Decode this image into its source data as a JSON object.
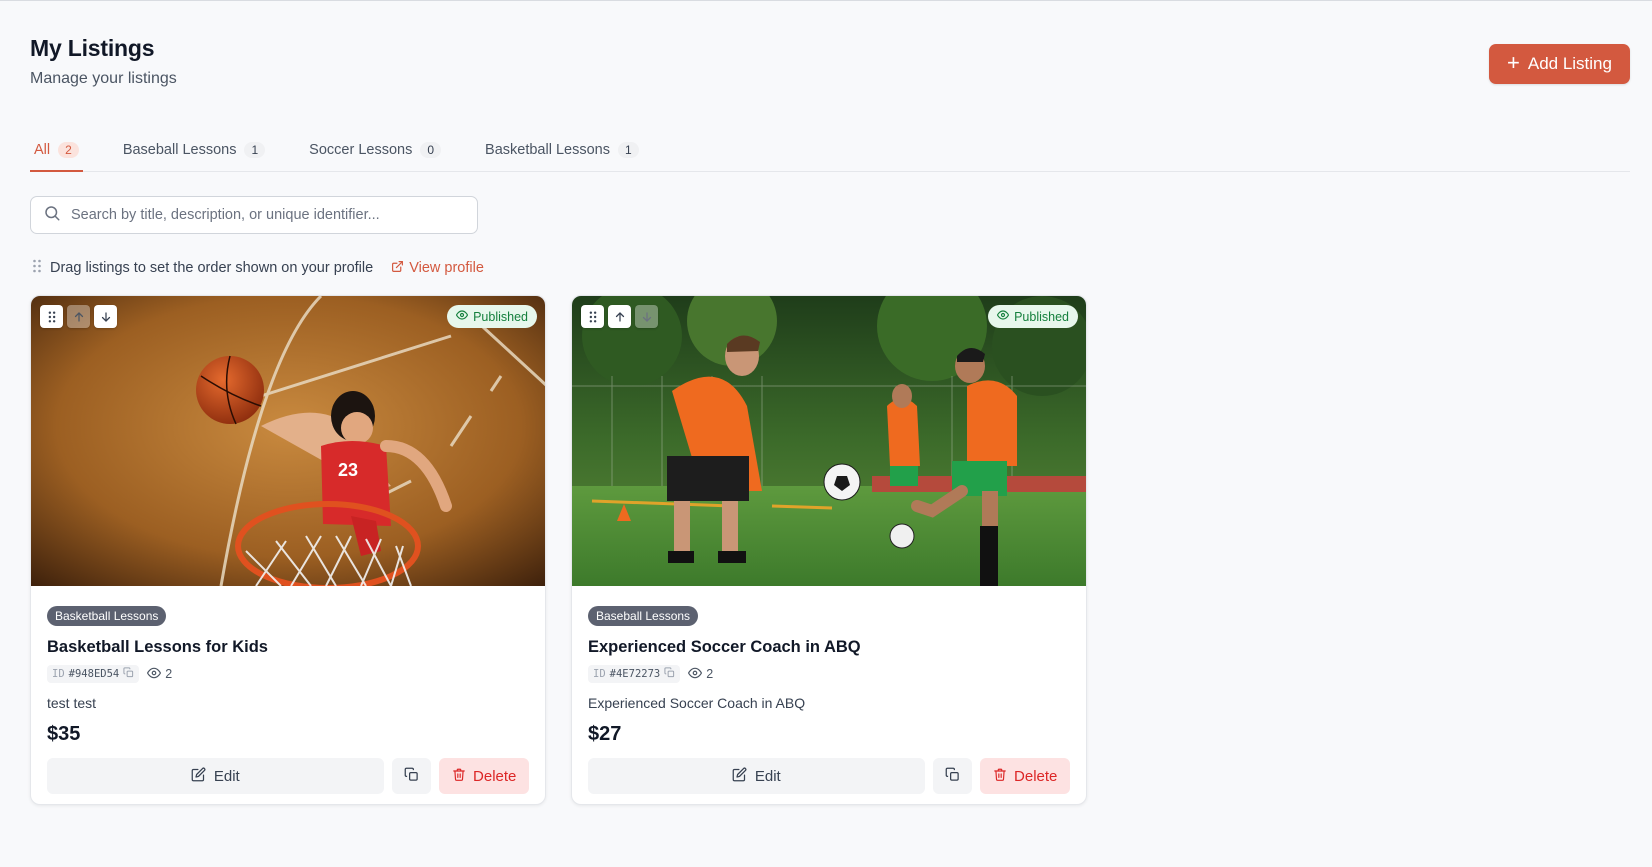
{
  "header": {
    "title": "My Listings",
    "subtitle": "Manage your listings",
    "add_button_label": "Add Listing"
  },
  "colors": {
    "accent": "#d3593f",
    "published_bg": "#e7f7ec",
    "published_text": "#15803d",
    "delete_bg": "#fde2e2",
    "delete_text": "#dc2626"
  },
  "tabs": [
    {
      "label": "All",
      "count": "2",
      "active": true
    },
    {
      "label": "Baseball Lessons",
      "count": "1"
    },
    {
      "label": "Soccer Lessons",
      "count": "0"
    },
    {
      "label": "Basketball Lessons",
      "count": "1"
    }
  ],
  "search": {
    "placeholder": "Search by title, description, or unique identifier...",
    "value": ""
  },
  "hint": {
    "text": "Drag listings to set the order shown on your profile",
    "view_profile_label": "View profile"
  },
  "listings": [
    {
      "status": "Published",
      "category": "Basketball Lessons",
      "title": "Basketball Lessons for Kids",
      "id_label": "ID",
      "id": "#948ED54",
      "views": "2",
      "description": "test test",
      "price": "$35",
      "edit_label": "Edit",
      "delete_label": "Delete",
      "image": "basketball-player-dunk-photo"
    },
    {
      "status": "Published",
      "category": "Baseball Lessons",
      "title": "Experienced Soccer Coach in ABQ",
      "id_label": "ID",
      "id": "#4E72273",
      "views": "2",
      "description": "Experienced Soccer Coach in ABQ",
      "price": "$27",
      "edit_label": "Edit",
      "delete_label": "Delete",
      "image": "soccer-coach-training-kids-photo"
    }
  ]
}
